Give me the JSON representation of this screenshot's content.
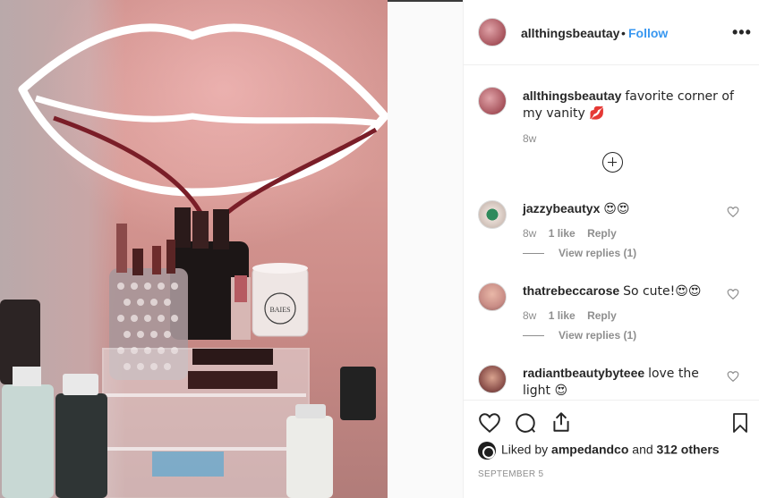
{
  "post": {
    "username": "allthingsbeautay",
    "separator": "•",
    "follow_label": "Follow",
    "more_label": "•••"
  },
  "caption": {
    "username": "allthingsbeautay",
    "text": "favorite corner of my vanity 💋",
    "time": "8w"
  },
  "comments": [
    {
      "username": "jazzybeautyx",
      "text": "😍😍",
      "time": "8w",
      "likes": "1 like",
      "reply_label": "Reply",
      "replies": "View replies (1)"
    },
    {
      "username": "thatrebeccarose",
      "text": "So cute!😍😍",
      "time": "8w",
      "likes": "1 like",
      "reply_label": "Reply",
      "replies": "View replies (1)"
    },
    {
      "username": "radiantbeautybyteee",
      "text": "love the light 😍"
    }
  ],
  "likes": {
    "prefix": "Liked by",
    "user": "ampedandco",
    "middle": "and",
    "others": "312 others"
  },
  "date": "SEPTEMBER 5",
  "photo": {
    "candle_label": "BAIES"
  },
  "colors": {
    "accent": "#3897f0",
    "text": "#262626",
    "muted": "#8e8e8e",
    "border": "#efefef"
  },
  "icons": [
    "more-icon",
    "add-circle-icon",
    "heart-icon",
    "comment-icon",
    "share-icon",
    "bookmark-icon"
  ]
}
